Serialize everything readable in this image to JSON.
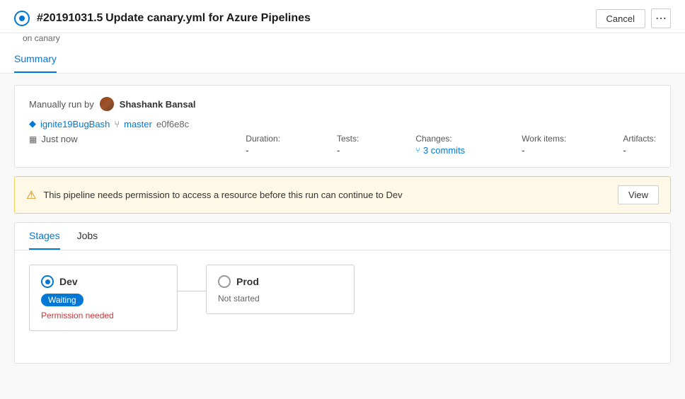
{
  "header": {
    "run_number": "#20191031.5",
    "title": "Update canary.yml for Azure Pipelines",
    "subtitle": "on canary",
    "cancel_label": "Cancel",
    "more_icon": "⋯"
  },
  "nav": {
    "tabs": [
      {
        "id": "summary",
        "label": "Summary",
        "active": true
      }
    ]
  },
  "summary_card": {
    "manually_run_label": "Manually run by",
    "user_name": "Shashank Bansal",
    "tag": "ignite19BugBash",
    "branch": "master",
    "commit": "e0f6e8c",
    "time_label": "Just now",
    "stats": {
      "duration_label": "Duration:",
      "duration_value": "-",
      "tests_label": "Tests:",
      "tests_value": "-",
      "changes_label": "Changes:",
      "changes_value": "3 commits",
      "work_items_label": "Work items:",
      "work_items_value": "-",
      "artifacts_label": "Artifacts:",
      "artifacts_value": "-"
    }
  },
  "warning": {
    "text": "This pipeline needs permission to access a resource before this run can continue to Dev",
    "view_label": "View"
  },
  "stages": {
    "tab_stages": "Stages",
    "tab_jobs": "Jobs",
    "items": [
      {
        "id": "dev",
        "name": "Dev",
        "status": "running",
        "badge": "Waiting",
        "sub_label": "Permission needed"
      },
      {
        "id": "prod",
        "name": "Prod",
        "status": "not-started",
        "badge": null,
        "sub_label": "Not started"
      }
    ]
  }
}
